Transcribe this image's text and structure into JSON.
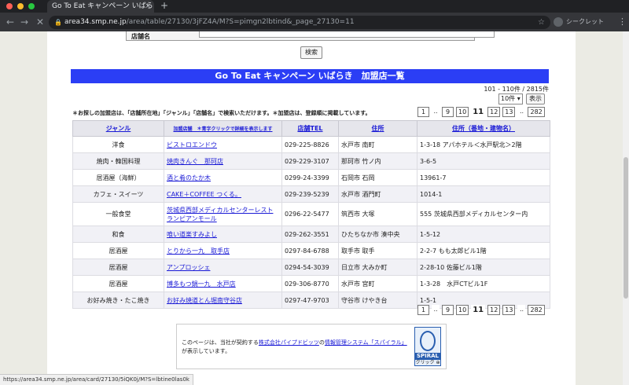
{
  "browser": {
    "tab_title": "Go To Eat キャンペーン いばらき",
    "tab_close": "×",
    "new_tab": "+",
    "url_host": "area34.smp.ne.jp",
    "url_path": "/area/table/27130/3jFZ4A/M?S=pimgn2lbtind&_page_27130=11",
    "incognito_label": "シークレット",
    "menu": "⋮",
    "back": "←",
    "forward": "→",
    "reload": "✕",
    "star": "☆",
    "lock": "🔒"
  },
  "search_form": {
    "shop_name_label": "店舗名",
    "search_button": "検索"
  },
  "banner_title": "Go To Eat キャンペーン いばらき　加盟店一覧",
  "result_count": "101 - 110件 / 2815件",
  "per_page": {
    "selected": "10件 ▾",
    "show_button": "表示"
  },
  "notice": "＊お探しの加盟店は、「店舗所在地」「ジャンル」「店舗名」で検索いただけます。＊加盟店は、登録順に掲載しています。",
  "pager": {
    "first": "1",
    "dots": "..",
    "pages": [
      "9",
      "10",
      "11",
      "12",
      "13"
    ],
    "current": "11",
    "last": "282"
  },
  "table": {
    "headers": {
      "genre": "ジャンル",
      "name": "加盟店舗　＊青字クリックで詳細を表示します",
      "tel": "店舗TEL",
      "address": "住所",
      "address2": "住所（番地・建物名）"
    },
    "rows": [
      {
        "genre": "洋食",
        "name": "ビストロエンドウ",
        "tel": "029-225-8826",
        "address": "水戸市 南町",
        "address2": "1-3-18 アパホテル＜水戸駅北＞2階"
      },
      {
        "genre": "焼肉・韓国料理",
        "name": "焼肉きんぐ　那珂店",
        "tel": "029-229-3107",
        "address": "那珂市 竹ノ内",
        "address2": "3-6-5"
      },
      {
        "genre": "居酒屋（海鮮）",
        "name": "酒と肴のたか木",
        "tel": "0299-24-3399",
        "address": "石岡市 石岡",
        "address2": "13961-7"
      },
      {
        "genre": "カフェ・スイーツ",
        "name": "CAKE＋COFFEE つくる。",
        "tel": "029-239-5239",
        "address": "水戸市 酒門町",
        "address2": "1014-1"
      },
      {
        "genre": "一般食堂",
        "name": "茨城県西部メディカルセンターレストランピアンモール",
        "tel": "0296-22-5477",
        "address": "筑西市 大塚",
        "address2": "555 茨城県西部メディカルセンター内"
      },
      {
        "genre": "和食",
        "name": "喰い道楽すみよし",
        "tel": "029-262-3551",
        "address": "ひたちなか市 湊中央",
        "address2": "1-5-12"
      },
      {
        "genre": "居酒屋",
        "name": "とりから一九　取手店",
        "tel": "0297-84-6788",
        "address": "取手市 取手",
        "address2": "2-2-7 もも太郎ビル1階"
      },
      {
        "genre": "居酒屋",
        "name": "アンプロッシェ",
        "tel": "0294-54-3039",
        "address": "日立市 大みか町",
        "address2": "2-28-10 佐藤ビル1階"
      },
      {
        "genre": "居酒屋",
        "name": "博多もつ鍋一九　水戸店",
        "tel": "029-306-8770",
        "address": "水戸市 宮町",
        "address2": "1-3-28　水戸CTビル1F"
      },
      {
        "genre": "お好み焼き・たこ焼き",
        "name": "お好み焼道とん堀南守谷店",
        "tel": "0297-47-9703",
        "address": "守谷市 けやき台",
        "address2": "1-5-1"
      }
    ]
  },
  "footer": {
    "text_before": "このページは、当社が契約する",
    "link1": "株式会社パイプドビッツ",
    "text_mid": "の",
    "link2": "情報管理システム「スパイラル」",
    "text_after": "が表示しています。",
    "logo_word": "SPIRAL",
    "logo_click": "クリック ⊕"
  },
  "status_bar_url": "https://area34.smp.ne.jp/area/card/27130/5iQK0j/M?S=lbtine0las0k"
}
